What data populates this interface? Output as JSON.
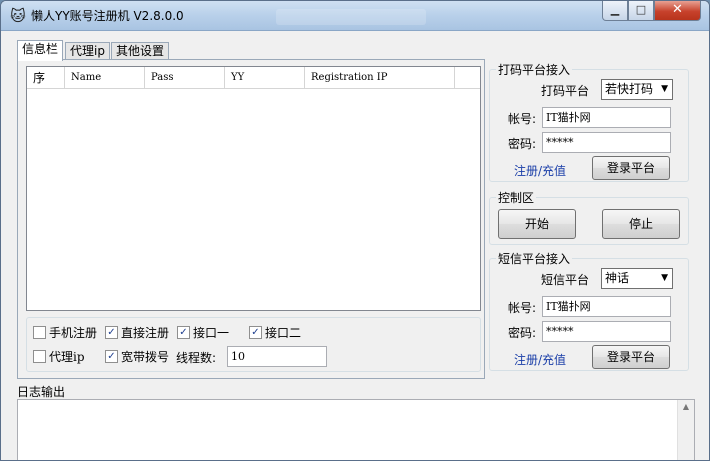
{
  "window": {
    "title": "懒人YY账号注册机   V2.8.0.0",
    "icon": "cat-icon",
    "controls": {
      "minimize": "▁",
      "maximize": "□",
      "close": "✕"
    }
  },
  "tabs": [
    {
      "label": "信息栏"
    },
    {
      "label": "代理ip"
    },
    {
      "label": "其他设置"
    }
  ],
  "list": {
    "columns": [
      "序",
      "Name",
      "Pass",
      "YY",
      "Registration IP"
    ]
  },
  "options": {
    "phone_reg": {
      "label": "手机注册",
      "checked": false
    },
    "direct_reg": {
      "label": "直接注册",
      "checked": true
    },
    "port1": {
      "label": "接口一",
      "checked": true
    },
    "port2": {
      "label": "接口二",
      "checked": true
    },
    "proxy_ip": {
      "label": "代理ip",
      "checked": false
    },
    "broadband": {
      "label": "宽带拨号",
      "checked": true
    },
    "thread_label": "线程数:",
    "thread_value": "10"
  },
  "captcha_platform": {
    "group_title": "打码平台接入",
    "platform_label": "打码平台",
    "platform_value": "若快打码",
    "account_label": "帐号:",
    "account_value": "IT猫扑网",
    "password_label": "密码:",
    "password_value": "*****",
    "register_link": "注册/充值",
    "login_button": "登录平台"
  },
  "control": {
    "group_title": "控制区",
    "start_button": "开始",
    "stop_button": "停止"
  },
  "sms_platform": {
    "group_title": "短信平台接入",
    "platform_label": "短信平台",
    "platform_value": "神话",
    "account_label": "帐号:",
    "account_value": "IT猫扑网",
    "password_label": "密码:",
    "password_value": "*****",
    "register_link": "注册/充值",
    "login_button": "登录平台"
  },
  "log": {
    "title": "日志输出"
  }
}
